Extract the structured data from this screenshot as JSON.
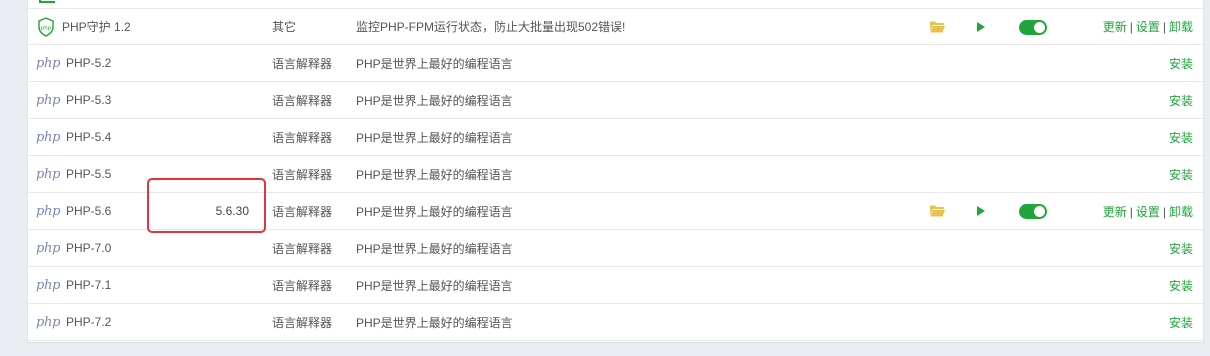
{
  "colors": {
    "accent": "#20a53a",
    "highlight": "#e2343b",
    "folder": "#e7c251"
  },
  "rows": [
    {
      "icon": "shield-icon",
      "name": "PHP守护 1.2",
      "version": "",
      "type": "其它",
      "desc": "监控PHP-FPM运行状态，防止大批量出现502错误!",
      "installed": true,
      "ops": [
        "更新",
        "设置",
        "卸载"
      ]
    },
    {
      "icon": "php-logo-icon",
      "logo": "php",
      "name": "PHP-5.2",
      "version": "",
      "type": "语言解释器",
      "desc": "PHP是世界上最好的编程语言",
      "installed": false,
      "ops": [
        "安装"
      ]
    },
    {
      "icon": "php-logo-icon",
      "logo": "php",
      "name": "PHP-5.3",
      "version": "",
      "type": "语言解释器",
      "desc": "PHP是世界上最好的编程语言",
      "installed": false,
      "ops": [
        "安装"
      ]
    },
    {
      "icon": "php-logo-icon",
      "logo": "php",
      "name": "PHP-5.4",
      "version": "",
      "type": "语言解释器",
      "desc": "PHP是世界上最好的编程语言",
      "installed": false,
      "ops": [
        "安装"
      ]
    },
    {
      "icon": "php-logo-icon",
      "logo": "php",
      "name": "PHP-5.5",
      "version": "",
      "type": "语言解释器",
      "desc": "PHP是世界上最好的编程语言",
      "installed": false,
      "ops": [
        "安装"
      ]
    },
    {
      "icon": "php-logo-icon",
      "logo": "php",
      "name": "PHP-5.6",
      "version": "5.6.30",
      "type": "语言解释器",
      "desc": "PHP是世界上最好的编程语言",
      "installed": true,
      "ops": [
        "更新",
        "设置",
        "卸载"
      ]
    },
    {
      "icon": "php-logo-icon",
      "logo": "php",
      "name": "PHP-7.0",
      "version": "",
      "type": "语言解释器",
      "desc": "PHP是世界上最好的编程语言",
      "installed": false,
      "ops": [
        "安装"
      ]
    },
    {
      "icon": "php-logo-icon",
      "logo": "php",
      "name": "PHP-7.1",
      "version": "",
      "type": "语言解释器",
      "desc": "PHP是世界上最好的编程语言",
      "installed": false,
      "ops": [
        "安装"
      ]
    },
    {
      "icon": "php-logo-icon",
      "logo": "php",
      "name": "PHP-7.2",
      "version": "",
      "type": "语言解释器",
      "desc": "PHP是世界上最好的编程语言",
      "installed": false,
      "ops": [
        "安装"
      ]
    }
  ]
}
